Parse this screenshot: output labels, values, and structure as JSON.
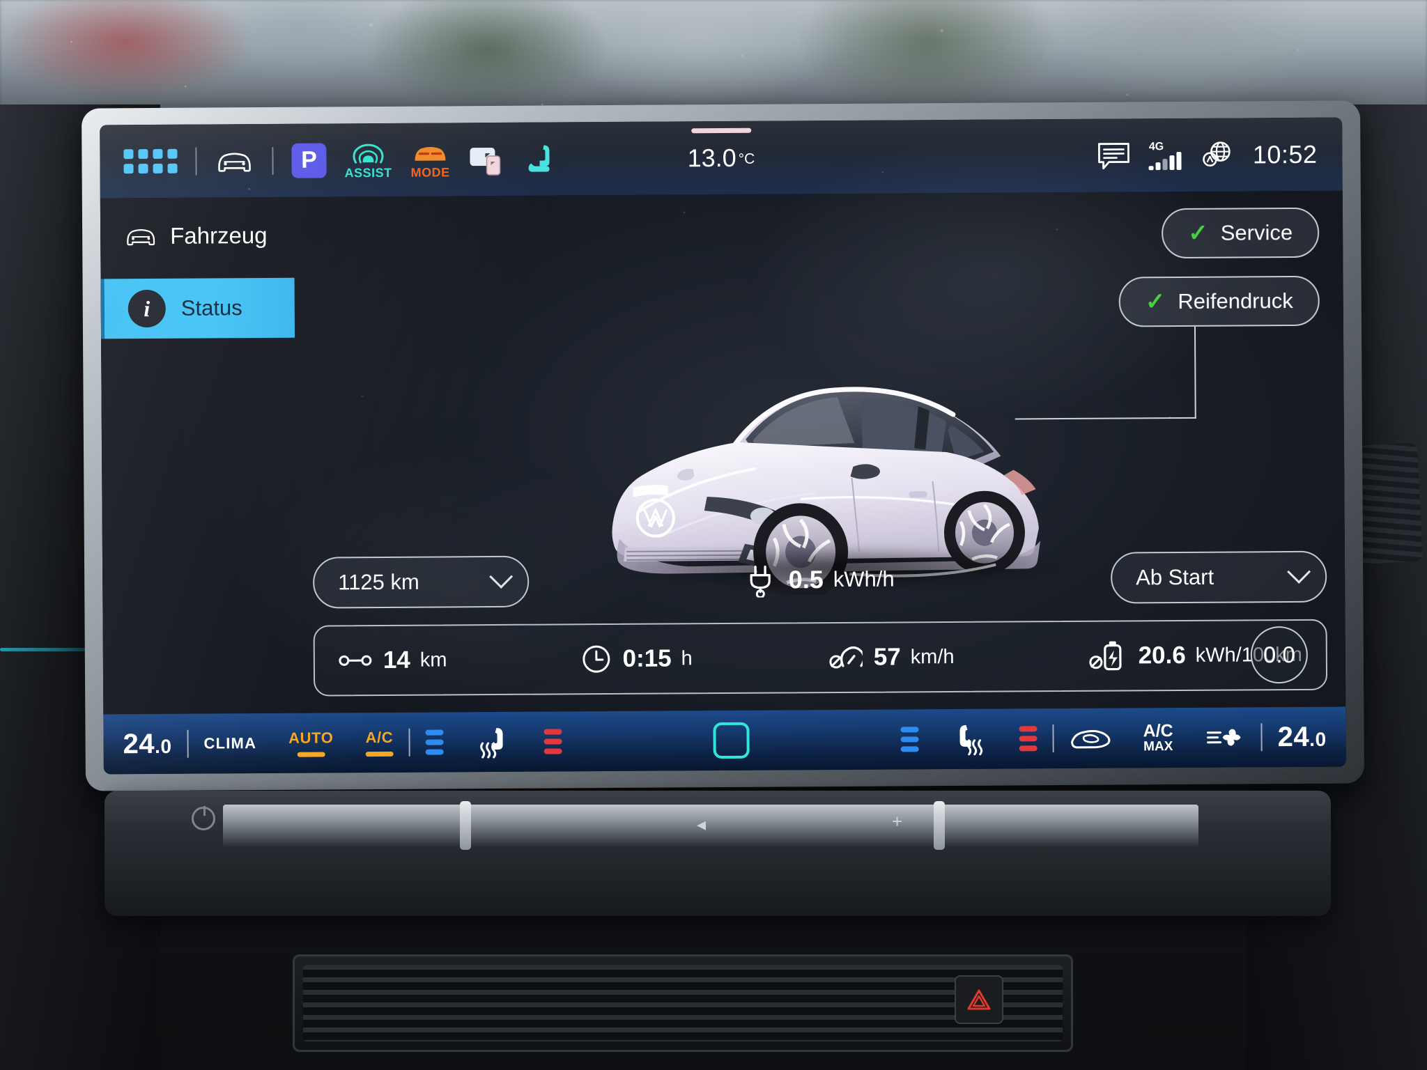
{
  "statusbar": {
    "apps_icon": "app-grid-icon",
    "car_icon": "car-front-icon",
    "park_label": "P",
    "assist_label": "ASSIST",
    "mode_label": "MODE",
    "phone_icon": "phone-projection-icon",
    "seat_icon": "seat-icon",
    "outside_temp": "13.0",
    "temp_unit": "°C",
    "message_icon": "message-icon",
    "network_type": "4G",
    "globe_icon": "globe-connectivity-icon",
    "clock": "10:52"
  },
  "sidebar": {
    "header": {
      "label": "Fahrzeug",
      "icon": "car-front-icon"
    },
    "items": [
      {
        "label": "Status",
        "icon": "info-icon",
        "selected": true
      }
    ]
  },
  "main": {
    "status_pills": [
      {
        "label": "Service",
        "state_icon": "check-icon",
        "state_color": "#46d23c"
      },
      {
        "label": "Reifendruck",
        "state_icon": "check-icon",
        "state_color": "#46d23c"
      }
    ],
    "vehicle_image_name": "vw-id7-vehicle-render",
    "range_dropdown": {
      "value": "1125 km",
      "chevron": "chevron-down-icon"
    },
    "live_consumption": {
      "icon": "charging-plug-icon",
      "value": "0.5",
      "unit": "kWh/h"
    },
    "period_dropdown": {
      "value": "Ab Start",
      "chevron": "chevron-down-icon"
    },
    "trip_stats": [
      {
        "icon": "distance-icon",
        "value": "14",
        "unit": "km"
      },
      {
        "icon": "clock-icon",
        "value": "0:15",
        "unit": "h"
      },
      {
        "icon": "speedometer-icon",
        "value": "57",
        "unit": "km/h"
      },
      {
        "icon": "battery-consumption-icon",
        "value": "20.6",
        "unit": "kWh/100km"
      }
    ],
    "trip_badge": "0.0"
  },
  "climate": {
    "temp_left": "24",
    "temp_left_dec": ".0",
    "clima_label": "CLIMA",
    "auto": {
      "label": "AUTO",
      "active": true
    },
    "ac": {
      "label": "A/C",
      "active": true
    },
    "left_fan_icon": "fan-level-icon",
    "left_seat_icon": "seat-heating-icon",
    "left_seat_level_icon": "seat-level-icon",
    "sync_icon": "climate-sync-icon",
    "right_fan_icon": "fan-level-icon",
    "right_seat_icon": "seat-heating-icon",
    "right_seat_level_icon": "seat-level-icon",
    "recirc_icon": "air-recirculation-icon",
    "ac_max": {
      "line1": "A/C",
      "line2": "MAX"
    },
    "blower_icon": "blower-icon",
    "temp_right": "24",
    "temp_right_dec": ".0"
  },
  "colors": {
    "accent_blue": "#3ec0f5",
    "park_purple": "#5a58e8",
    "assist_teal": "#35e3cf",
    "mode_orange": "#f0641e",
    "ok_green": "#46d23c",
    "climate_amber": "#f5a623",
    "climate_bar_blue": "#1d4a8a"
  }
}
